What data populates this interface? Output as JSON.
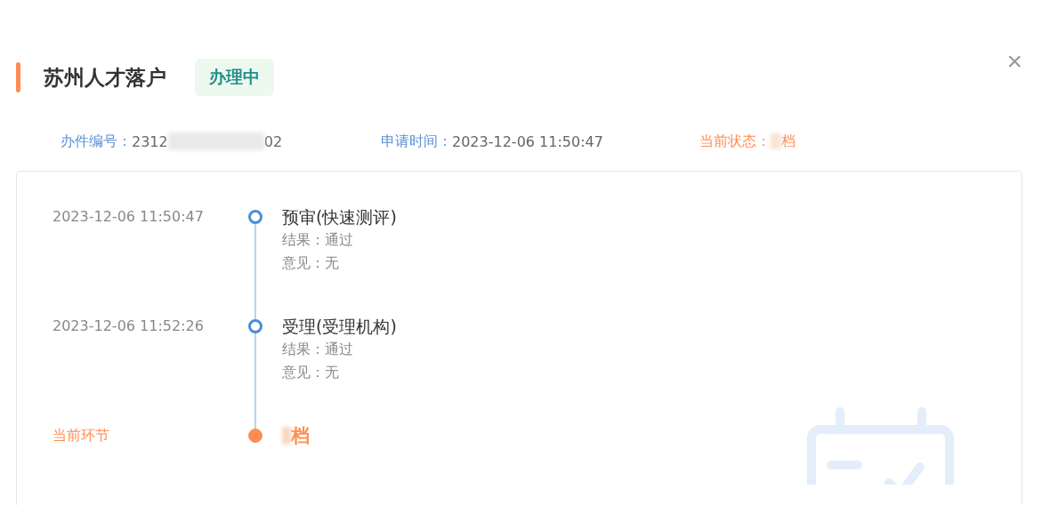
{
  "header": {
    "title": "苏州人才落户",
    "badge": "办理中",
    "close": "×"
  },
  "info": [
    {
      "kind": "redacted",
      "label": "办件编号：",
      "value_start": "2312",
      "value_end": "02"
    },
    {
      "kind": "plain",
      "label": "申请时间：",
      "value": "2023-12-06 11:50:47"
    },
    {
      "kind": "status",
      "label": "当前状态：",
      "value": "档"
    }
  ],
  "timeline": [
    {
      "kind": "done",
      "time": "2023-12-06 11:50:47",
      "title": "预审(快速测评)",
      "lines": [
        "结果：通过",
        "意见：无"
      ]
    },
    {
      "kind": "done",
      "time": "2023-12-06 11:52:26",
      "title": "受理(受理机构)",
      "lines": [
        "结果：通过",
        "意见：无"
      ]
    },
    {
      "kind": "current",
      "time": "当前环节",
      "title": "档"
    }
  ]
}
